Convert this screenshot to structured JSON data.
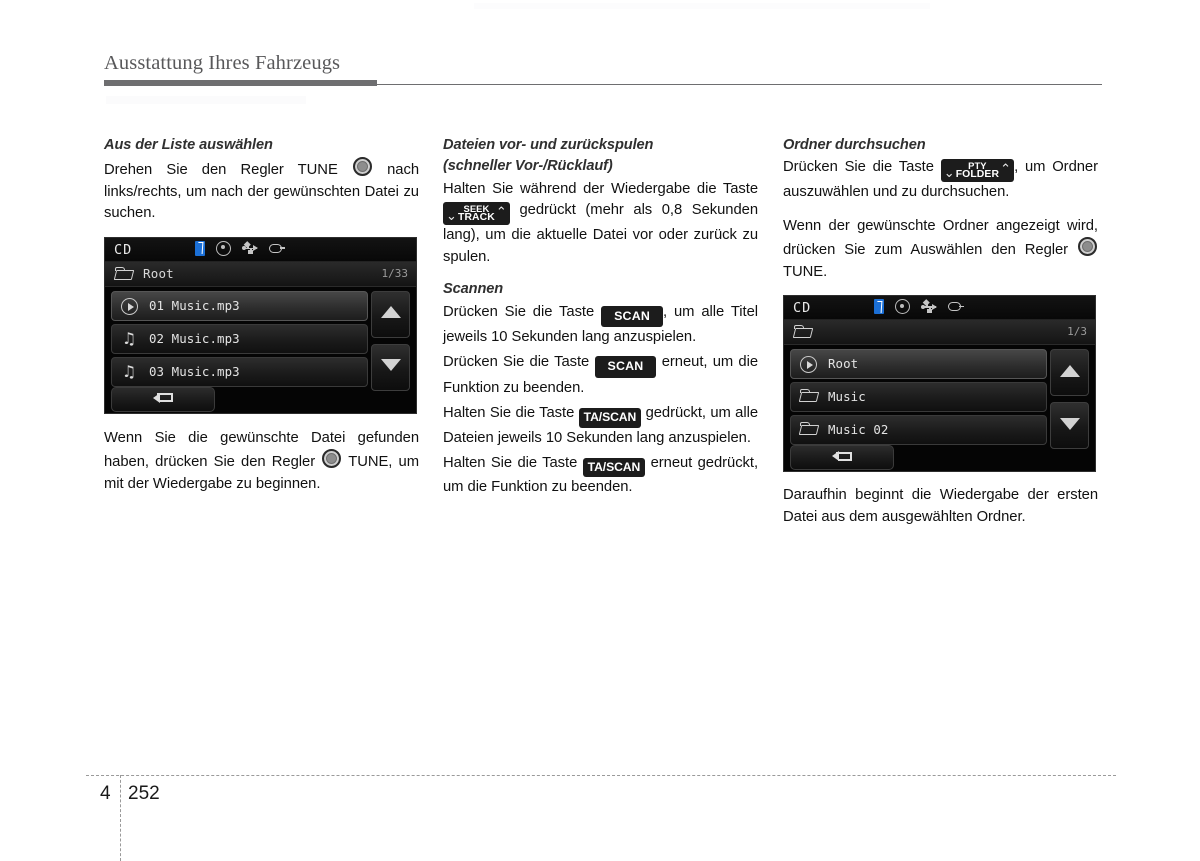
{
  "document": {
    "header_title": "Ausstattung Ihres Fahrzeugs",
    "footer_chapter": "4",
    "footer_page": "252"
  },
  "columns": {
    "left": {
      "heading": "Aus der Liste auswählen",
      "para_1_part_1": "Drehen Sie den Regler TUNE",
      "para_1_part_2": "nach links/rechts, um nach der gewünschten Datei zu suchen.",
      "para_2_part_1": "Wenn Sie die gewünschte Datei gefunden haben, drücken Sie den Regler",
      "para_2_part_2": "TUNE, um mit der Wiedergabe zu beginnen.",
      "knob_icon": "tune-knob-icon"
    },
    "middle": {
      "heading_line_1": "Dateien vor- und zurückspulen",
      "heading_line_2": "(schneller Vor-/Rücklauf)",
      "para_1_part_1": "Halten Sie während der Wiedergabe die Taste",
      "para_1_part_2": "gedrückt (mehr als 0,8 Sekunden lang), um die aktuelle Datei vor oder zurück zu spulen.",
      "seek_button": {
        "line_1": "SEEK",
        "line_2": "TRACK",
        "chevron_left": "⌄",
        "chevron_right": "⌃"
      },
      "scan_heading": "Scannen",
      "scan_para_1_part_1": "Drücken Sie die Taste",
      "scan_para_1_part_2": ", um alle Titel jeweils 10 Sekunden lang anzuspielen.",
      "scan_para_2_part_1": "Drücken Sie die Taste",
      "scan_para_2_part_2": "erneut, um die Funktion zu beenden.",
      "scan_para_3_part_1": "Halten Sie die Taste",
      "scan_para_3_part_2": "gedrückt, um alle Dateien jeweils 10 Sekunden lang anzuspielen.",
      "scan_para_4_part_1": "Halten Sie die Taste",
      "scan_para_4_part_2": "erneut gedrückt, um die Funktion zu beenden.",
      "scan_button_label": "SCAN",
      "tascan_button_label": "TA/SCAN"
    },
    "right": {
      "heading": "Ordner durchsuchen",
      "para_1_part_1": "Drücken Sie die Taste",
      "para_1_part_2": ", um Ordner auszuwählen und zu durchsuchen.",
      "folder_button": {
        "line_1": "PTY",
        "line_2": "FOLDER",
        "chevron_left": "⌄",
        "chevron_right": "⌃"
      },
      "para_2_part_1": "Wenn der gewünschte Ordner angezeigt wird, drücken Sie zum Auswählen den Regler",
      "para_2_part_2": "TUNE.",
      "para_3": "Daraufhin beginnt die Wiedergabe der ersten Datei aus dem ausgewählten Ordner."
    }
  },
  "screens": [
    {
      "id": "cd-file-list-screen",
      "source_label": "CD",
      "status_icons": [
        "bluetooth-icon",
        "disc-icon",
        "usb-icon",
        "aux-plug-icon"
      ],
      "path_label": "Root",
      "page_indicator": "1/33",
      "rows": [
        {
          "icon": "play-icon",
          "label": "01 Music.mp3",
          "selected": true
        },
        {
          "icon": "music-note-icon",
          "label": "02 Music.mp3",
          "selected": false
        },
        {
          "icon": "music-note-icon",
          "label": "03 Music.mp3",
          "selected": false
        }
      ],
      "scroll_up": "scroll-up-icon",
      "scroll_down": "scroll-down-icon",
      "back_button": "back-icon"
    },
    {
      "id": "cd-folder-list-screen",
      "source_label": "CD",
      "status_icons": [
        "bluetooth-icon",
        "disc-icon",
        "usb-icon",
        "aux-plug-icon"
      ],
      "path_label": "",
      "page_indicator": "1/3",
      "rows": [
        {
          "icon": "play-icon",
          "label": "Root",
          "selected": true
        },
        {
          "icon": "folder-icon",
          "label": "Music",
          "selected": false
        },
        {
          "icon": "folder-icon",
          "label": "Music 02",
          "selected": false
        }
      ],
      "scroll_up": "scroll-up-icon",
      "scroll_down": "scroll-down-icon",
      "back_button": "back-icon"
    }
  ]
}
